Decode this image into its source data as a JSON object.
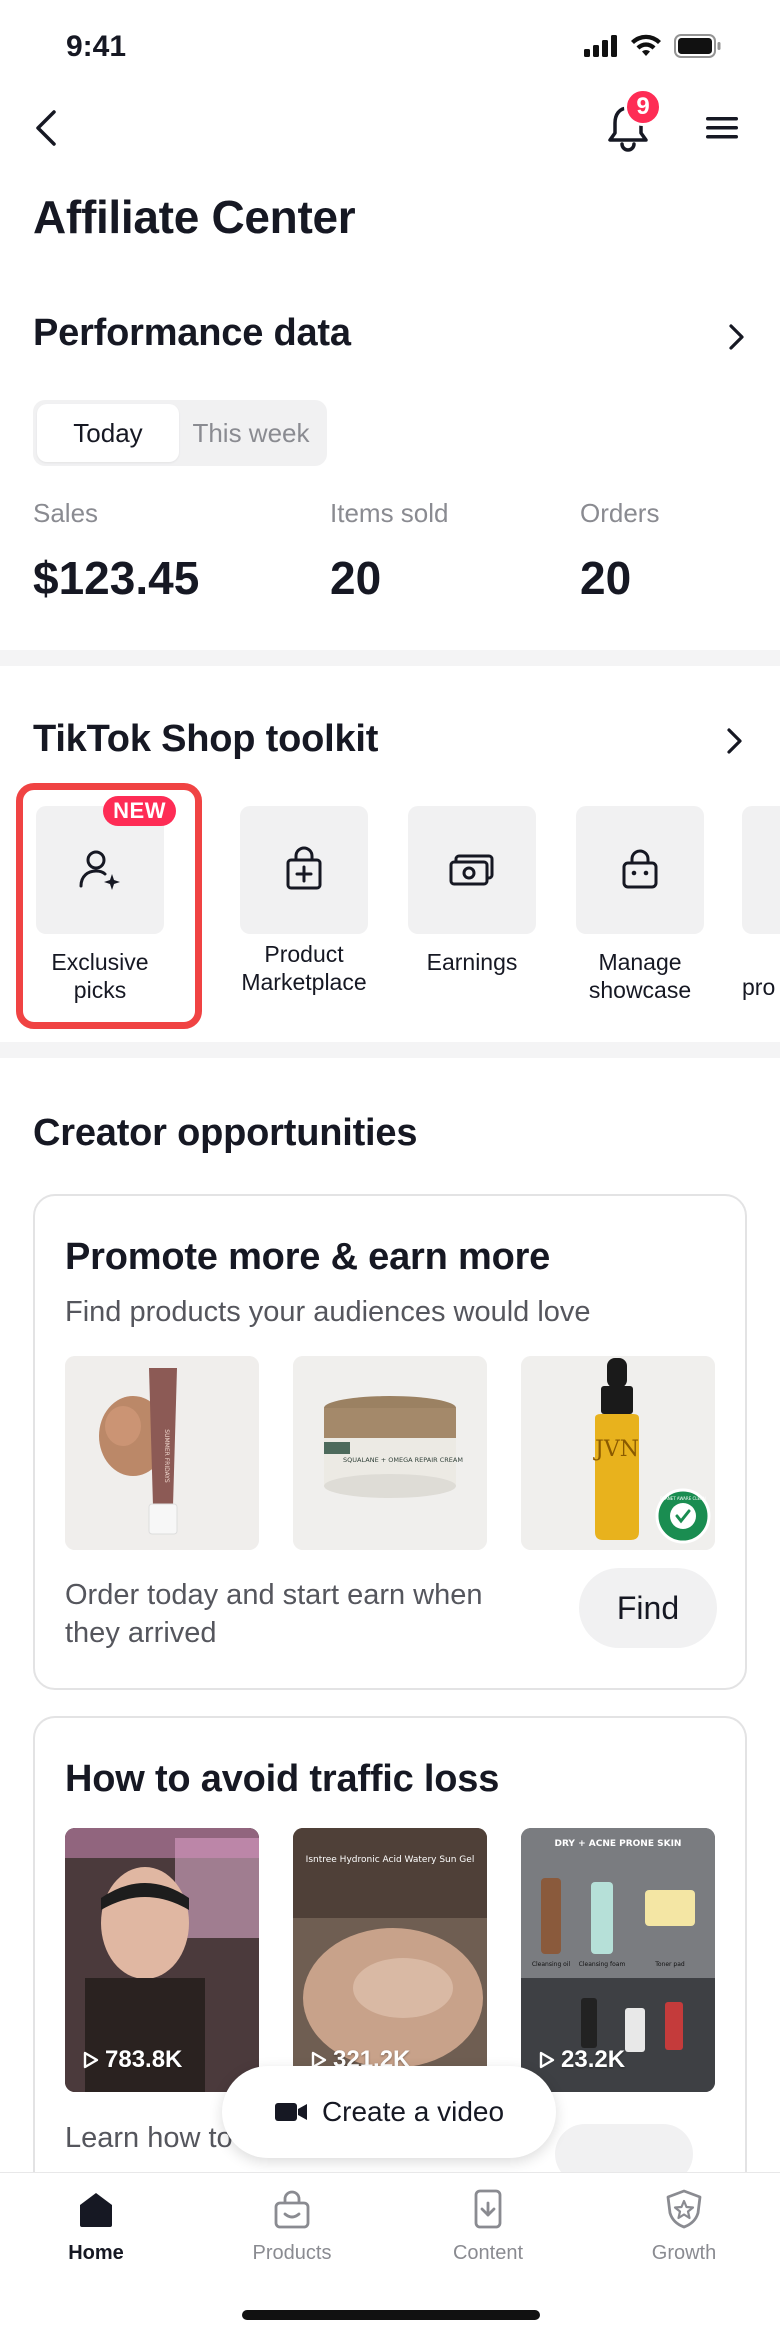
{
  "status_bar": {
    "time": "9:41"
  },
  "nav": {
    "notification_count": "9"
  },
  "page_title": "Affiliate Center",
  "performance": {
    "title": "Performance data",
    "tabs": [
      "Today",
      "This week"
    ],
    "active_tab": "Today",
    "metrics": [
      {
        "label": "Sales",
        "value": "$123.45"
      },
      {
        "label": "Items sold",
        "value": "20"
      },
      {
        "label": "Orders",
        "value": "20"
      }
    ]
  },
  "toolkit": {
    "title": "TikTok Shop toolkit",
    "new_badge": "NEW",
    "items": [
      {
        "label": "Exclusive picks",
        "icon": "user-plus-icon"
      },
      {
        "label": "Product Marketplace",
        "icon": "shopping-bag-plus-icon"
      },
      {
        "label": "Earnings",
        "icon": "cash-icon"
      },
      {
        "label": "Manage showcase",
        "icon": "basket-icon"
      },
      {
        "label": "pro",
        "icon": "unknown-icon"
      }
    ]
  },
  "opportunities": {
    "title": "Creator opportunities",
    "promote_card": {
      "title": "Promote more & earn more",
      "subtitle": "Find products your audiences would love",
      "footer": "Order today and start earn when they arrived",
      "find_label": "Find",
      "product_texts": [
        "SUMMER FRIDAYS",
        "SQUALANE + OMEGA REPAIR CREAM",
        "JVN",
        "PLANET AWARE CLEAN"
      ]
    },
    "traffic_card": {
      "title": "How to avoid traffic loss",
      "videos": [
        {
          "views": "783.8K"
        },
        {
          "views": "321.2K",
          "caption": "Isntree Hydronic Acid Watery Sun Gel"
        },
        {
          "views": "23.2K",
          "caption": "DRY + ACNE PRONE SKIN",
          "labels": [
            "Cleansing oil",
            "Cleansing foam",
            "Toner pad"
          ]
        }
      ],
      "footer_partial": "Learn how to"
    }
  },
  "create_video": {
    "label": "Create a video"
  },
  "bottom_nav": {
    "items": [
      {
        "label": "Home",
        "active": true
      },
      {
        "label": "Products",
        "active": false
      },
      {
        "label": "Content",
        "active": false
      },
      {
        "label": "Growth",
        "active": false
      }
    ]
  }
}
